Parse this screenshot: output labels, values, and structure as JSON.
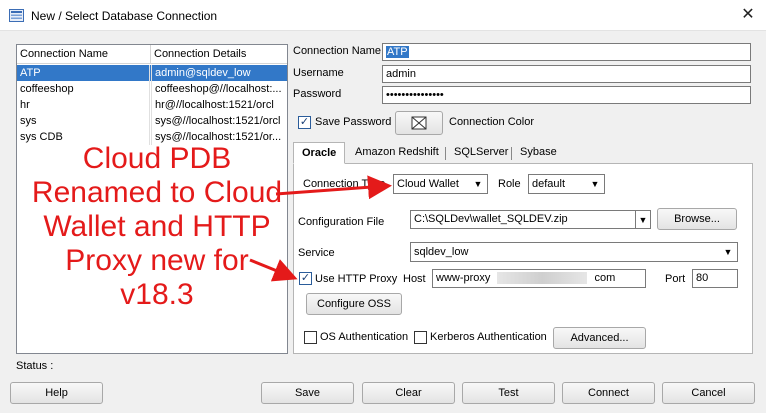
{
  "window": {
    "title": "New / Select Database Connection",
    "close_glyph": "✕"
  },
  "connections": {
    "headers": [
      "Connection Name",
      "Connection Details"
    ],
    "rows": [
      {
        "name": "ATP",
        "details": "admin@sqldev_low",
        "selected": true
      },
      {
        "name": "coffeeshop",
        "details": "coffeeshop@//localhost:..."
      },
      {
        "name": "hr",
        "details": "hr@//localhost:1521/orcl"
      },
      {
        "name": "sys",
        "details": "sys@//localhost:1521/orcl"
      },
      {
        "name": "sys CDB",
        "details": "sys@//localhost:1521/or..."
      }
    ]
  },
  "form": {
    "connection_name_label": "Connection Name",
    "connection_name_value": "ATP",
    "username_label": "Username",
    "username_value": "admin",
    "password_label": "Password",
    "password_value": "•••••••••••••••",
    "save_password_label": "Save Password",
    "connection_color_label": "Connection Color"
  },
  "tabs": [
    "Oracle",
    "Amazon Redshift",
    "SQLServer",
    "Sybase"
  ],
  "oracle": {
    "connection_type_label": "Connection Type",
    "connection_type_value": "Cloud Wallet",
    "role_label": "Role",
    "role_value": "default",
    "config_file_label": "Configuration File",
    "config_file_value": "C:\\SQLDev\\wallet_SQLDEV.zip",
    "browse_label": "Browse...",
    "service_label": "Service",
    "service_value": "sqldev_low",
    "use_http_proxy_label": "Use HTTP Proxy",
    "host_label": "Host",
    "host_value_prefix": "www-proxy",
    "host_value_suffix": "com",
    "port_label": "Port",
    "port_value": "80",
    "configure_oss_label": "Configure OSS",
    "os_auth_label": "OS Authentication",
    "kerberos_auth_label": "Kerberos Authentication",
    "advanced_label": "Advanced..."
  },
  "annotation": {
    "lines": [
      "Cloud PDB",
      "Renamed to Cloud",
      "Wallet and HTTP",
      "Proxy new for",
      "v18.3"
    ],
    "color": "#e41a1a"
  },
  "status_label": "Status :",
  "buttons": {
    "help": "Help",
    "save": "Save",
    "clear": "Clear",
    "test": "Test",
    "connect": "Connect",
    "cancel": "Cancel"
  },
  "colors": {
    "selection": "#3278c8",
    "annotation_red": "#e41a1a"
  },
  "icons": {
    "app": "database-connection-icon",
    "color_swatch": "color-picker-icon"
  }
}
